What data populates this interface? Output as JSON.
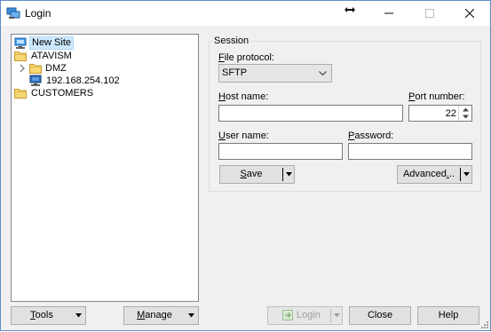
{
  "window": {
    "title": "Login"
  },
  "tree": {
    "items": [
      {
        "label": "New Site"
      },
      {
        "label": "ATAVISM"
      },
      {
        "label": "DMZ"
      },
      {
        "label": "192.168.254.102"
      },
      {
        "label": "CUSTOMERS"
      }
    ]
  },
  "session": {
    "group_title": "Session",
    "file_protocol_label_prefix": "F",
    "file_protocol_label_rest": "ile protocol:",
    "file_protocol_value": "SFTP",
    "host_label_prefix": "H",
    "host_label_rest": "ost name:",
    "host_value": "",
    "port_label_prefix": "P",
    "port_label_rest": "ort number:",
    "port_value": "22",
    "user_label_prefix": "U",
    "user_label_rest": "ser name:",
    "user_value": "",
    "password_label_prefix": "P",
    "password_label_rest": "assword:",
    "password_value": "",
    "save_prefix": "S",
    "save_rest": "ave",
    "advanced_prefix": "Advanced",
    "advanced_ul": ".",
    "advanced_rest": ".."
  },
  "footer": {
    "tools_prefix": "T",
    "tools_rest": "ools",
    "manage_prefix": "M",
    "manage_rest": "anage",
    "login_label": "Login",
    "close_label": "Close",
    "help_label": "Help"
  },
  "colors": {
    "accent": "#0078d7",
    "selection": "#cce8ff",
    "folder": "#f8d775"
  }
}
